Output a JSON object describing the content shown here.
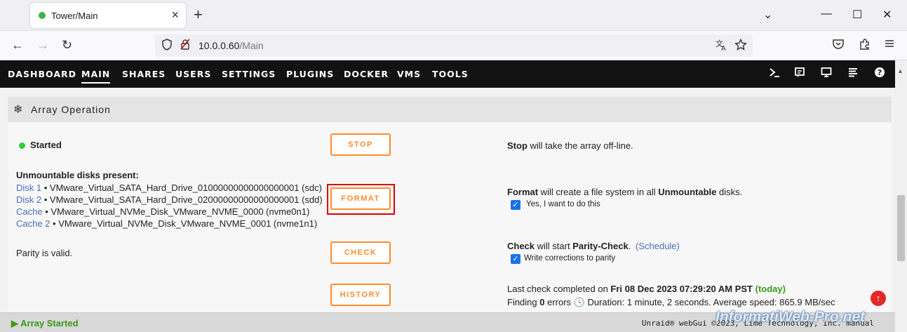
{
  "browser": {
    "tab_title": "Tower/Main",
    "tab_close": "×",
    "new_tab": "+",
    "window_controls": {
      "list": "⌄",
      "minimize": "—",
      "maximize": "☐",
      "close": "✕"
    },
    "nav": {
      "back": "←",
      "forward": "→",
      "reload": "↻"
    },
    "url_host": "10.0.0.60",
    "url_path": "/Main",
    "icons": {
      "shield": "shield-icon",
      "lock": "insecure-lock-icon",
      "translate": "translate-icon",
      "star": "bookmark-star-icon",
      "pocket": "pocket-icon",
      "extensions": "extensions-icon",
      "menu": "hamburger-menu-icon"
    }
  },
  "menu": {
    "items": [
      {
        "label": "DASHBOARD"
      },
      {
        "label": "MAIN",
        "active": true
      },
      {
        "label": "SHARES"
      },
      {
        "label": "USERS"
      },
      {
        "label": "SETTINGS"
      },
      {
        "label": "PLUGINS"
      },
      {
        "label": "DOCKER"
      },
      {
        "label": "VMS"
      },
      {
        "label": "TOOLS"
      }
    ],
    "icons": [
      "terminal-icon",
      "feedback-icon",
      "monitor-icon",
      "log-icon",
      "help-icon"
    ]
  },
  "section": {
    "title": "Array Operation",
    "icon": "snowflake-icon"
  },
  "array": {
    "status": "Started",
    "stop_button": "STOP",
    "stop_desc_bold": "Stop",
    "stop_desc": " will take the array off-line.",
    "unmountable_heading": "Unmountable disks present:",
    "disks": [
      {
        "name": "Disk 1",
        "detail": " • VMware_Virtual_SATA_Hard_Drive_01000000000000000001 (sdc)"
      },
      {
        "name": "Disk 2",
        "detail": " • VMware_Virtual_SATA_Hard_Drive_02000000000000000001 (sdd)"
      },
      {
        "name": "Cache",
        "detail": " • VMware_Virtual_NVMe_Disk_VMware_NVME_0000 (nvme0n1)"
      },
      {
        "name": "Cache 2",
        "detail": " • VMware_Virtual_NVMe_Disk_VMware_NVME_0001 (nvme1n1)"
      }
    ],
    "format_button": "FORMAT",
    "format_desc_bold": "Format",
    "format_desc_mid": " will create a file system in all ",
    "format_desc_bold2": "Unmountable",
    "format_desc_end": " disks.",
    "format_confirm": "Yes, I want to do this",
    "parity_status": "Parity is valid.",
    "check_button": "CHECK",
    "check_desc_bold": "Check",
    "check_desc_mid": " will start ",
    "check_desc_bold2": "Parity-Check",
    "check_desc_end": ".",
    "schedule_link": "(Schedule)",
    "write_corrections": "Write corrections to parity",
    "history_button": "HISTORY",
    "last_check_prefix": "Last check completed on ",
    "last_check_date": "Fri 08 Dec 2023 07:29:20 AM PST",
    "last_check_today": "(today)",
    "finding": "Finding ",
    "errors_count": "0",
    "errors_suffix": " errors ",
    "duration": " Duration: 1 minute, 2 seconds. Average speed: 865.9 MB/sec"
  },
  "footer": {
    "status": "Array Started",
    "copyright": "Unraid® webGui ©2023, Lime Technology, Inc. manual"
  },
  "watermark": "InformatiWeb-Pro.net",
  "colors": {
    "accent": "#ff8c2f",
    "highlight": "#dd0000",
    "ok": "#3a9a1a",
    "link": "#486dba",
    "menu_bg": "#121212"
  }
}
